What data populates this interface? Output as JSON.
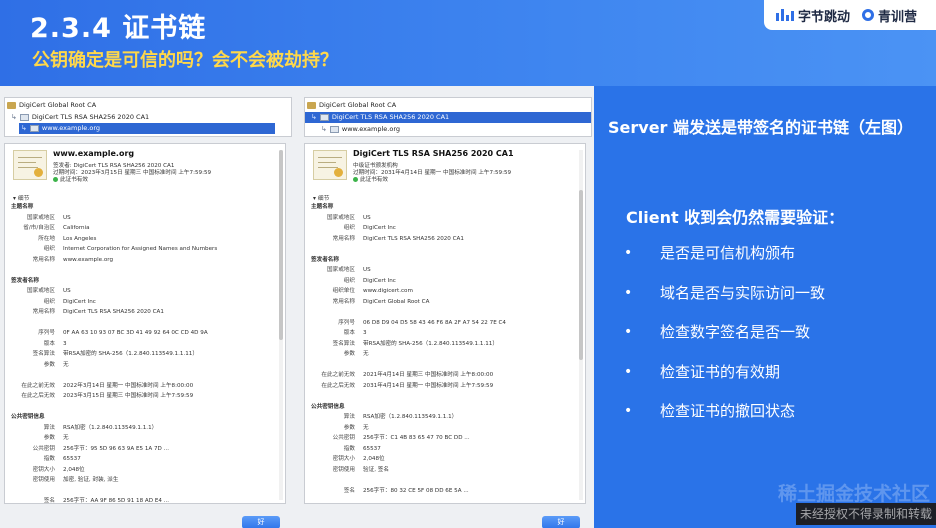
{
  "header": {
    "title": "2.3.4 证书链",
    "subtitle": "公钥确定是可信的吗？会不会被劫持？",
    "logos": {
      "bytedance": "字节跳动",
      "qingxun": "青训营"
    }
  },
  "right_panel": {
    "server_text": "Server 端发送是带签名的证书链（左图）",
    "client_text": "Client 收到会仍然需要验证：",
    "bullets": [
      "是否是可信机构颁布",
      "域名是否与实际访问一致",
      "检查数字签名是否一致",
      "检查证书的有效期",
      "检查证书的撤回状态"
    ],
    "watermark": "稀土掘金技术社区",
    "footer": "未经授权不得录制和转载"
  },
  "windows": [
    {
      "tree": [
        {
          "label": "DigiCert Global Root CA",
          "icon": "folder-icon",
          "selected": false
        },
        {
          "label": "DigiCert TLS RSA SHA256 2020 CA1",
          "icon": "cert-icon",
          "selected": false
        },
        {
          "label": "www.example.org",
          "icon": "cert-icon",
          "selected": true
        }
      ],
      "cert": {
        "name": "www.example.org",
        "issuer": "签发者: DigiCert TLS RSA SHA256 2020 CA1",
        "expiry": "过期时间：2023年3月15日 星期三 中国标准时间 上午7:59:59",
        "status": "此证书有效"
      },
      "details_label": "细节",
      "fields": [
        {
          "k": "主题名称",
          "v": "",
          "sec": true
        },
        {
          "k": "国家或地区",
          "v": "US"
        },
        {
          "k": "省/市/自治区",
          "v": "California"
        },
        {
          "k": "所在地",
          "v": "Los Angeles"
        },
        {
          "k": "组织",
          "v": "Internet Corporation for Assigned Names and Numbers"
        },
        {
          "k": "常用名称",
          "v": "www.example.org"
        },
        {
          "k": "",
          "v": ""
        },
        {
          "k": "签发者名称",
          "v": "",
          "sec": true
        },
        {
          "k": "国家或地区",
          "v": "US"
        },
        {
          "k": "组织",
          "v": "DigiCert Inc"
        },
        {
          "k": "常用名称",
          "v": "DigiCert TLS RSA SHA256 2020 CA1"
        },
        {
          "k": "",
          "v": ""
        },
        {
          "k": "序列号",
          "v": "0F AA 63 10 93 07 BC 3D 41 49 92 64 0C CD 4D 9A"
        },
        {
          "k": "版本",
          "v": "3"
        },
        {
          "k": "签名算法",
          "v": "带RSA加密的 SHA-256（1.2.840.113549.1.1.11）"
        },
        {
          "k": "参数",
          "v": "无"
        },
        {
          "k": "",
          "v": ""
        },
        {
          "k": "在此之前无效",
          "v": "2022年3月14日 星期一 中国标准时间 上午8:00:00"
        },
        {
          "k": "在此之后无效",
          "v": "2023年3月15日 星期三 中国标准时间 上午7:59:59"
        },
        {
          "k": "",
          "v": ""
        },
        {
          "k": "公共密钥信息",
          "v": "",
          "sec": true
        },
        {
          "k": "算法",
          "v": "RSA加密（1.2.840.113549.1.1.1）"
        },
        {
          "k": "参数",
          "v": "无"
        },
        {
          "k": "公共密钥",
          "v": "256字节：95 5D 96 63 9A E5 1A 7D ..."
        },
        {
          "k": "指数",
          "v": "65537"
        },
        {
          "k": "密钥大小",
          "v": "2,048位"
        },
        {
          "k": "密钥使用",
          "v": "加密, 验证, 封装, 派生"
        },
        {
          "k": "",
          "v": ""
        },
        {
          "k": "签名",
          "v": "256字节：AA 9F 86 5D 91 18 AD E4 ..."
        }
      ],
      "ok_label": "好"
    },
    {
      "tree": [
        {
          "label": "DigiCert Global Root CA",
          "icon": "folder-icon",
          "selected": false
        },
        {
          "label": "DigiCert TLS RSA SHA256 2020 CA1",
          "icon": "cert-icon",
          "selected": true
        },
        {
          "label": "www.example.org",
          "icon": "cert-icon",
          "selected": false
        }
      ],
      "cert": {
        "name": "DigiCert TLS RSA SHA256 2020 CA1",
        "issuer": "中级证书颁发机构",
        "expiry": "过期时间：2031年4月14日 星期一 中国标准时间 上午7:59:59",
        "status": "此证书有效"
      },
      "details_label": "细节",
      "fields": [
        {
          "k": "主题名称",
          "v": "",
          "sec": true
        },
        {
          "k": "国家或地区",
          "v": "US"
        },
        {
          "k": "组织",
          "v": "DigiCert Inc"
        },
        {
          "k": "常用名称",
          "v": "DigiCert TLS RSA SHA256 2020 CA1"
        },
        {
          "k": "",
          "v": ""
        },
        {
          "k": "签发者名称",
          "v": "",
          "sec": true
        },
        {
          "k": "国家或地区",
          "v": "US"
        },
        {
          "k": "组织",
          "v": "DigiCert Inc"
        },
        {
          "k": "组织单位",
          "v": "www.digicert.com"
        },
        {
          "k": "常用名称",
          "v": "DigiCert Global Root CA"
        },
        {
          "k": "",
          "v": ""
        },
        {
          "k": "序列号",
          "v": "06 D8 D9 04 D5 58 43 46 F6 8A 2F A7 54 22 7E C4"
        },
        {
          "k": "版本",
          "v": "3"
        },
        {
          "k": "签名算法",
          "v": "带RSA加密的 SHA-256（1.2.840.113549.1.1.11）"
        },
        {
          "k": "参数",
          "v": "无"
        },
        {
          "k": "",
          "v": ""
        },
        {
          "k": "在此之前无效",
          "v": "2021年4月14日 星期三 中国标准时间 上午8:00:00"
        },
        {
          "k": "在此之后无效",
          "v": "2031年4月14日 星期一 中国标准时间 上午7:59:59"
        },
        {
          "k": "",
          "v": ""
        },
        {
          "k": "公共密钥信息",
          "v": "",
          "sec": true
        },
        {
          "k": "算法",
          "v": "RSA加密（1.2.840.113549.1.1.1）"
        },
        {
          "k": "参数",
          "v": "无"
        },
        {
          "k": "公共密钥",
          "v": "256字节：C1 4B 83 65 47 70 BC DD ..."
        },
        {
          "k": "指数",
          "v": "65537"
        },
        {
          "k": "密钥大小",
          "v": "2,048位"
        },
        {
          "k": "密钥使用",
          "v": "验证, 签名"
        },
        {
          "k": "",
          "v": ""
        },
        {
          "k": "签名",
          "v": "256字节：80 32 CE 5F 08 DD 6E 5A ..."
        }
      ],
      "ok_label": "好"
    }
  ],
  "colors": {
    "header_blue": "#2f6fe6",
    "panel_blue": "#2a73e8",
    "subtitle_yellow": "#ffd84a",
    "selection_blue": "#2e67d3"
  }
}
